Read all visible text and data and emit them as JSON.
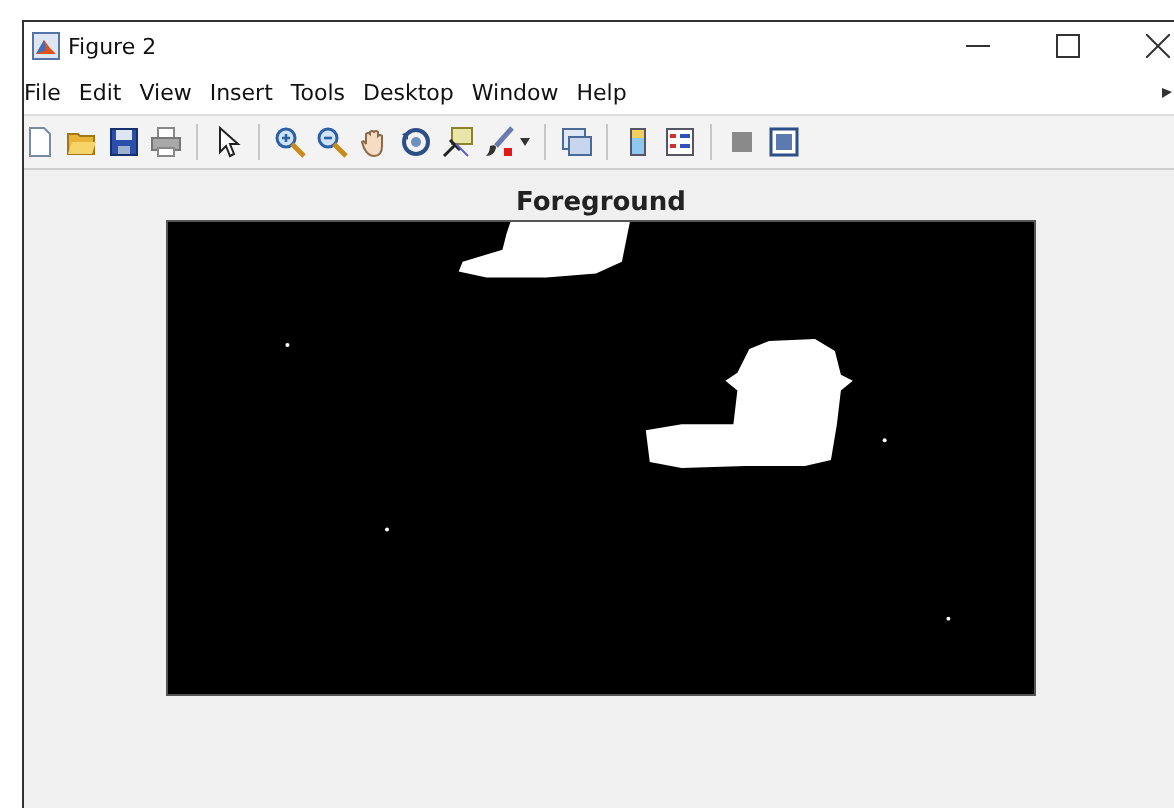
{
  "window": {
    "title": "Figure 2"
  },
  "menu": [
    "File",
    "Edit",
    "View",
    "Insert",
    "Tools",
    "Desktop",
    "Window",
    "Help"
  ],
  "axes": {
    "title": "Foreground"
  }
}
